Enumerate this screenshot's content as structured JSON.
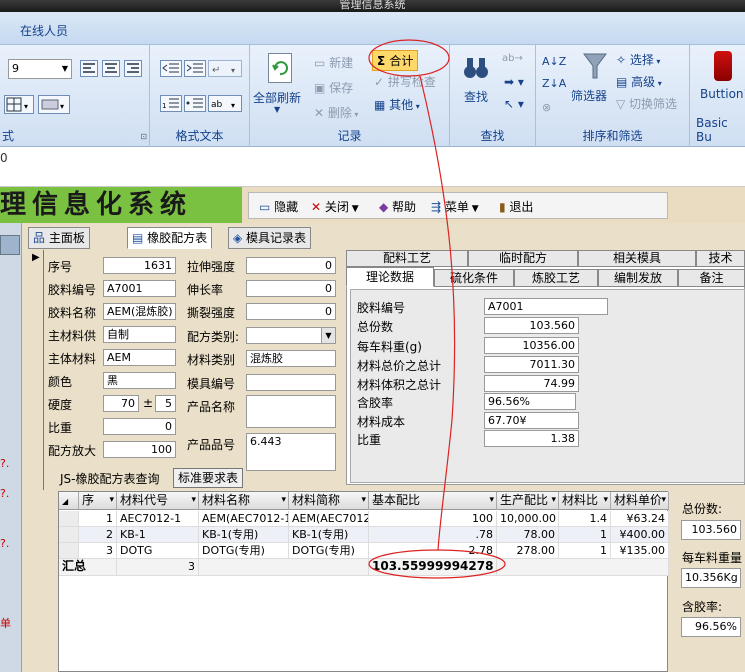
{
  "window": {
    "title": "管理信息系统"
  },
  "menubar": {
    "item": "在线人员"
  },
  "ribbon": {
    "font_size": "9",
    "groups": {
      "format": {
        "label": "格式文本"
      },
      "record": {
        "label": "记录",
        "refresh": "全部刷新",
        "new": "新建",
        "save": "保存",
        "delete": "删除",
        "total": "合计",
        "spell": "拼写检查",
        "other": "其他"
      },
      "find": {
        "label": "查找",
        "find": "查找"
      },
      "sortfilter": {
        "label": "排序和筛选",
        "filter": "筛选器",
        "select": "选择",
        "advanced": "高级",
        "toggle": "切换筛选"
      },
      "custom": {
        "label": "Basic Bu",
        "button": "Buttion1"
      }
    },
    "partial_left_label": "式"
  },
  "status": {
    "zoom": "0"
  },
  "banner": {
    "text": "理信息化系统"
  },
  "toolbar": {
    "hide": "隐藏",
    "close": "关闭",
    "help": "帮助",
    "menu": "菜单",
    "exit": "退出"
  },
  "tabs": {
    "main": "主面板",
    "rubber": "橡胶配方表",
    "mold": "模具记录表"
  },
  "form": {
    "seq_label": "序号",
    "seq": "1631",
    "code_label": "胶料编号",
    "code": "A7001",
    "name_label": "胶料名称",
    "name": "AEM(混炼胶)",
    "supplier_label": "主材料供",
    "supplier": "自制",
    "main_mat_label": "主体材料",
    "main_mat": "AEM",
    "color_label": "颜色",
    "color": "黑",
    "hardness_label": "硬度",
    "hardness": "70",
    "pm": "±",
    "tol": "5",
    "density_label": "比重",
    "density": "0",
    "scale_label": "配方放大",
    "scale": "100",
    "tensile_label": "拉伸强度",
    "tensile": "0",
    "elong_label": "伸长率",
    "elong": "0",
    "tear_label": "撕裂强度",
    "tear": "0",
    "ftype_label": "配方类别:",
    "ftype": "",
    "mtype_label": "材料类别",
    "mtype": "混炼胶",
    "mold_label": "模具编号",
    "mold": "",
    "product_label": "产品名称",
    "product": "",
    "pno_label": "产品品号",
    "pno": "6.443",
    "query_label": "JS-橡胶配方表查询",
    "std_button": "标准要求表"
  },
  "right_tabs": {
    "row1": [
      "配料工艺",
      "临时配方",
      "相关模具",
      "技术"
    ],
    "row2": [
      "理论数据",
      "硫化条件",
      "炼胶工艺",
      "编制发放",
      "备注"
    ]
  },
  "theory": {
    "rows": [
      {
        "label": "胶料编号",
        "value": "A7001"
      },
      {
        "label": "总份数",
        "value": "103.560"
      },
      {
        "label": "每车料重(g)",
        "value": "10356.00"
      },
      {
        "label": "材料总价之总计",
        "value": "7011.30"
      },
      {
        "label": "材料体积之总计",
        "value": "74.99"
      },
      {
        "label": "含胶率",
        "value": "96.56%"
      },
      {
        "label": "材料成本",
        "value": "67.70¥"
      },
      {
        "label": "比重",
        "value": "1.38"
      }
    ]
  },
  "grid": {
    "headers": [
      "序",
      "材料代号",
      "材料名称",
      "材料简称",
      "基本配比",
      "生产配比",
      "材料比",
      "材料单价"
    ],
    "rows": [
      [
        "1",
        "AEC7012-1",
        "AEM(AEC7012-1)",
        "AEM(AEC7012-1",
        "100",
        "10,000.00",
        "1.4",
        "¥63.24"
      ],
      [
        "2",
        "KB-1",
        "KB-1(专用)",
        "KB-1(专用)",
        ".78",
        "78.00",
        "1",
        "¥400.00"
      ],
      [
        "3",
        "DOTG",
        "DOTG(专用)",
        "DOTG(专用)",
        "2.78",
        "278.00",
        "1",
        "¥135.00"
      ]
    ],
    "total_label": "汇总",
    "total_count": "3",
    "total_sum": "103.55999994278"
  },
  "side": {
    "total_label": "总份数:",
    "total": "103.560",
    "weight_label": "每车料重量",
    "weight": "10.356Kg",
    "rubber_label": "含胶率:",
    "rubber": "96.56%"
  },
  "left_marks": [
    "?.",
    "?.",
    "?.",
    "单"
  ]
}
